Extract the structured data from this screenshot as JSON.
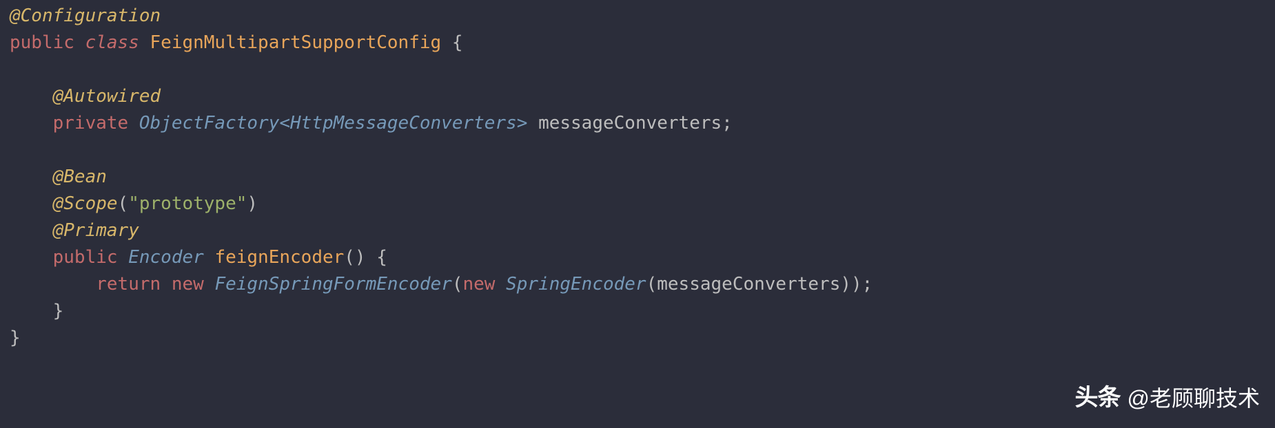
{
  "code": {
    "l1": {
      "annotation": "@Configuration"
    },
    "l2": {
      "kw_public": "public",
      "kw_class": "class",
      "class_name": "FeignMultipartSupportConfig",
      "brace": "{"
    },
    "l4": {
      "annotation": "@Autowired"
    },
    "l5": {
      "kw_private": "private",
      "type1": "ObjectFactory",
      "lt": "<",
      "type2": "HttpMessageConverters",
      "gt": ">",
      "ident": "messageConverters",
      "semi": ";"
    },
    "l7": {
      "annotation": "@Bean"
    },
    "l8": {
      "annotation": "@Scope",
      "lparen": "(",
      "str": "\"prototype\"",
      "rparen": ")"
    },
    "l9": {
      "annotation": "@Primary"
    },
    "l10": {
      "kw_public": "public",
      "type": "Encoder",
      "method": "feignEncoder",
      "parens": "()",
      "brace": "{"
    },
    "l11": {
      "kw_return": "return",
      "kw_new1": "new",
      "type1": "FeignSpringFormEncoder",
      "lparen1": "(",
      "kw_new2": "new",
      "type2": "SpringEncoder",
      "lparen2": "(",
      "ident": "messageConverters",
      "rparen2": ")",
      "rparen1": ")",
      "semi": ";"
    },
    "l12": {
      "brace": "}"
    },
    "l13": {
      "brace": "}"
    }
  },
  "watermark": {
    "logo": "头条",
    "at": "@",
    "text": "老顾聊技术"
  }
}
